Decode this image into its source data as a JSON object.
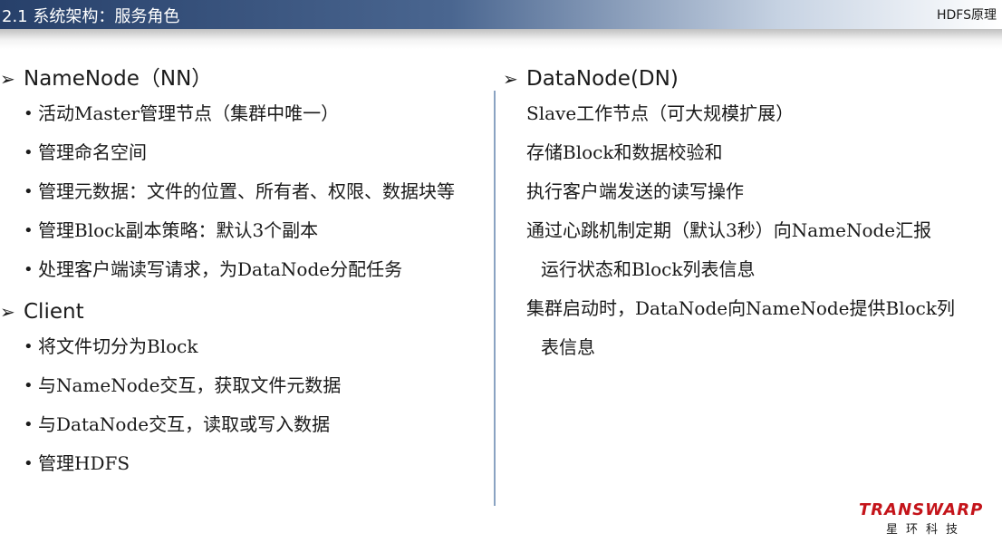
{
  "header": {
    "title": "2.1 系统架构：服务角色",
    "tag": "HDFS原理"
  },
  "icons": {
    "section_marker": "right-arrowhead-icon",
    "bullet": "bullet-dot-icon"
  },
  "left": {
    "namenode": {
      "heading": "NameNode（NN）",
      "items": [
        "活动Master管理节点（集群中唯一）",
        "管理命名空间",
        "管理元数据：文件的位置、所有者、权限、数据块等",
        "管理Block副本策略：默认3个副本",
        "处理客户端读写请求，为DataNode分配任务"
      ]
    },
    "client": {
      "heading": "Client",
      "items": [
        "将文件切分为Block",
        "与NameNode交互，获取文件元数据",
        "与DataNode交互，读取或写入数据",
        "管理HDFS"
      ]
    }
  },
  "right": {
    "datanode": {
      "heading": "DataNode(DN)",
      "items": [
        "Slave工作节点（可大规模扩展）",
        "存储Block和数据校验和",
        "执行客户端发送的读写操作",
        "通过心跳机制定期（默认3秒）向NameNode汇报",
        "运行状态和Block列表信息",
        "集群启动时，DataNode向NameNode提供Block列",
        "表信息"
      ]
    }
  },
  "logo": {
    "name": "TRANSWARP",
    "sub": "星环科技"
  },
  "marker_glyph": "➢",
  "bullet_glyph": "•"
}
